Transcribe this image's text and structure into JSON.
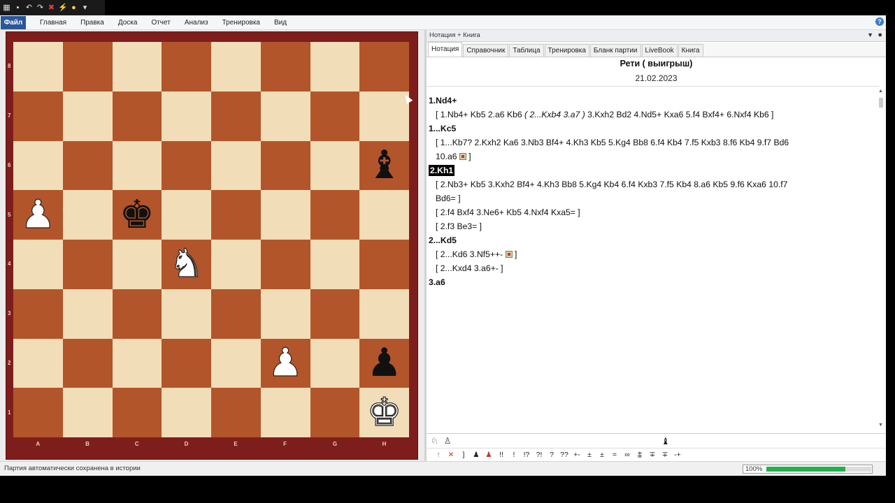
{
  "quick_access": {
    "icons": [
      "board-icon",
      "save-icon",
      "undo-icon",
      "redo-icon",
      "delete-icon",
      "tool-icon",
      "hint-icon",
      "dropdown-icon"
    ]
  },
  "menu": {
    "file": "Файл",
    "items": [
      "Главная",
      "Правка",
      "Доска",
      "Отчет",
      "Анализ",
      "Тренировка",
      "Вид"
    ]
  },
  "board": {
    "files": [
      "A",
      "B",
      "C",
      "D",
      "E",
      "F",
      "G",
      "H"
    ],
    "ranks": [
      "8",
      "7",
      "6",
      "5",
      "4",
      "3",
      "2",
      "1"
    ],
    "pieces": {
      "h6": {
        "glyph": "♝",
        "color": "black"
      },
      "a5": {
        "glyph": "♟",
        "color": "white"
      },
      "c5": {
        "glyph": "♚",
        "color": "black"
      },
      "d4": {
        "glyph": "♞",
        "color": "white"
      },
      "f2": {
        "glyph": "♟",
        "color": "white"
      },
      "h2": {
        "glyph": "♟",
        "color": "black"
      },
      "h1": {
        "glyph": "♚",
        "color": "white"
      }
    }
  },
  "pane": {
    "title": "Нотация + Книга",
    "tabs": [
      "Нотация",
      "Справочник",
      "Таблица",
      "Тренировка",
      "Бланк партии",
      "LiveBook",
      "Книга"
    ],
    "active_tab": "Нотация"
  },
  "game": {
    "title": "Рети ( выигрыш)",
    "date": "21.02.2023"
  },
  "notation": {
    "m1w": "1.Nd4+",
    "v1a_pre": "[ 1.Nb4+  Kb5  2.a6  Kb6 ",
    "v1a_sub": "( 2...Kxb4  3.a7 )",
    "v1a_post": " 3.Kxh2  Bd2  4.Nd5+  Kxa6  5.f4  Bxf4+  6.Nxf4  Kb6 ]",
    "m1b": "1...Kc5",
    "v1b_l1": "[ 1...Kb7?  2.Kxh2  Ka6  3.Nb3  Bf4+  4.Kh3  Kb5  5.Kg4  Bb8  6.f4  Kb4  7.f5  Kxb3  8.f6  Kb4  9.f7  Bd6",
    "v1b_l2a": "10.a6 ",
    "v1b_l2b": " ]",
    "m2w": "2.Kh1",
    "v2a_l1": "[ 2.Nb3+  Kb5  3.Kxh2  Bf4+  4.Kh3  Bb8  5.Kg4  Kb4  6.f4  Kxb3  7.f5  Kb4  8.a6  Kb5  9.f6  Kxa6  10.f7",
    "v2a_l2": "Bd6= ]",
    "v2b": "[ 2.f4  Bxf4  3.Ne6+  Kb5  4.Nxf4  Kxa5= ]",
    "v2c": "[ 2.f3  Be3= ]",
    "m2b": "2...Kd5",
    "v3a_pre": "[ 2...Kd6  3.Nf5++- ",
    "v3a_post": " ]",
    "v3b": "[ 2...Kxd4  3.a6+- ]",
    "m3w": "3.a6"
  },
  "annotation_bar": {
    "row2": [
      "↑",
      "✕",
      "]",
      "♟",
      "♟",
      "!!",
      "!",
      "!?",
      "?!",
      "?",
      "??",
      "+-",
      "±",
      "±",
      "=",
      "∞",
      "⩲",
      "∓",
      "∓",
      "-+"
    ]
  },
  "status": {
    "text": "Партия автоматически сохранена в истории",
    "zoom": "100%",
    "progress": 0.75
  },
  "colors": {
    "file_button": "#2b579a",
    "light_square": "#f1ddb8",
    "dark_square": "#b3552a",
    "board_frame": "#7e1e1c",
    "progress": "#22b14c"
  }
}
